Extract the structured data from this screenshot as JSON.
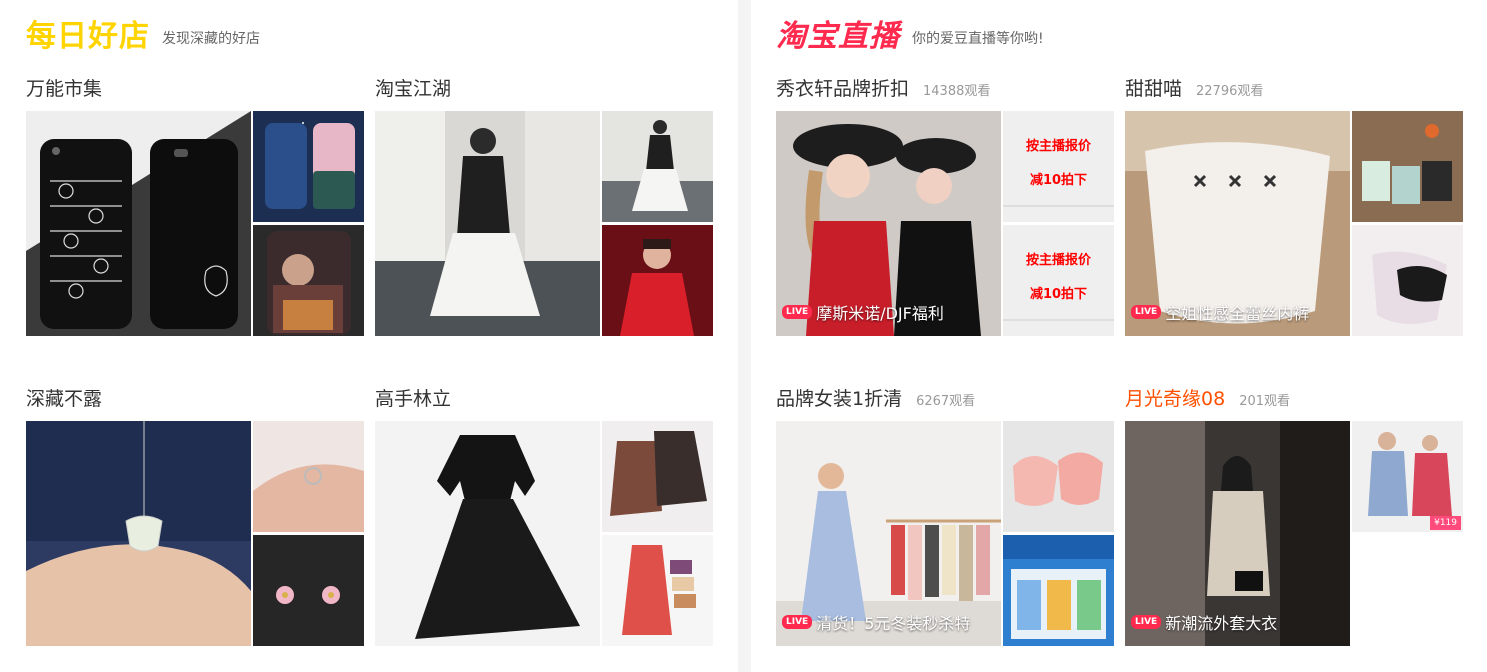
{
  "left": {
    "brand": {
      "logo": "每日好店",
      "tagline": "发现深藏的好店"
    },
    "cards": [
      {
        "title": "万能市集"
      },
      {
        "title": "淘宝江湖"
      },
      {
        "title": "深藏不露"
      },
      {
        "title": "高手林立"
      }
    ]
  },
  "right": {
    "brand": {
      "logo": "淘宝直播",
      "tagline": "你的爱豆直播等你哟!"
    },
    "live_badge": "LIVE",
    "cards": [
      {
        "title": "秀衣轩品牌折扣",
        "viewers": "14388观看",
        "live_caption": "摩斯米诺/DJF福利",
        "promo_line1": "按主播报价",
        "promo_line2": "减10拍下"
      },
      {
        "title": "甜甜喵",
        "viewers": "22796观看",
        "live_caption": "空姐性感全蕾丝内裤"
      },
      {
        "title": "品牌女装1折清",
        "viewers": "6267观看",
        "live_caption": "清货！5元冬装秒杀特"
      },
      {
        "title": "月光奇缘08",
        "viewers": "201观看",
        "live_caption": "新潮流外套大衣",
        "price_badge": "¥119"
      }
    ]
  },
  "colors": {
    "taobao_live": "#ff2a4e",
    "daily_shop": "#ffd400",
    "hot_title": "#ff5000"
  }
}
